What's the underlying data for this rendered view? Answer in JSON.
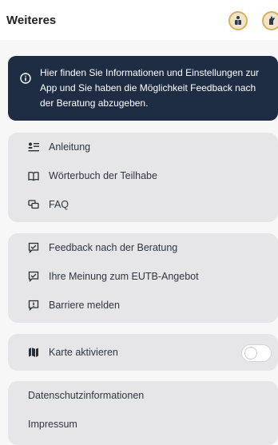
{
  "header": {
    "title": "Weiteres",
    "icons": [
      "accessibility-reading-icon",
      "sign-language-icon"
    ]
  },
  "info": {
    "text": "Hier finden Sie Informationen und Einstellungen zur App und Sie haben die Möglichkeit Feedback nach der Beratung abzugeben."
  },
  "section1": {
    "items": [
      {
        "label": "Anleitung",
        "icon": "guide-icon"
      },
      {
        "label": "Wörterbuch der Teilhabe",
        "icon": "book-icon"
      },
      {
        "label": "FAQ",
        "icon": "faq-icon"
      }
    ]
  },
  "section2": {
    "items": [
      {
        "label": "Feedback nach der Beratung",
        "icon": "feedback-icon"
      },
      {
        "label": "Ihre Meinung zum EUTB-Angebot",
        "icon": "opinion-icon"
      },
      {
        "label": "Barriere melden",
        "icon": "report-icon"
      }
    ]
  },
  "section3": {
    "label": "Karte aktivieren",
    "icon": "map-icon",
    "toggle_on": false
  },
  "section4": {
    "items": [
      {
        "label": "Datenschutzinformationen"
      },
      {
        "label": "Impressum"
      }
    ]
  },
  "colors": {
    "info_bg": "#1f2d44",
    "card_bg": "#e6e6e8",
    "header_icon_border": "#d9b05a"
  }
}
